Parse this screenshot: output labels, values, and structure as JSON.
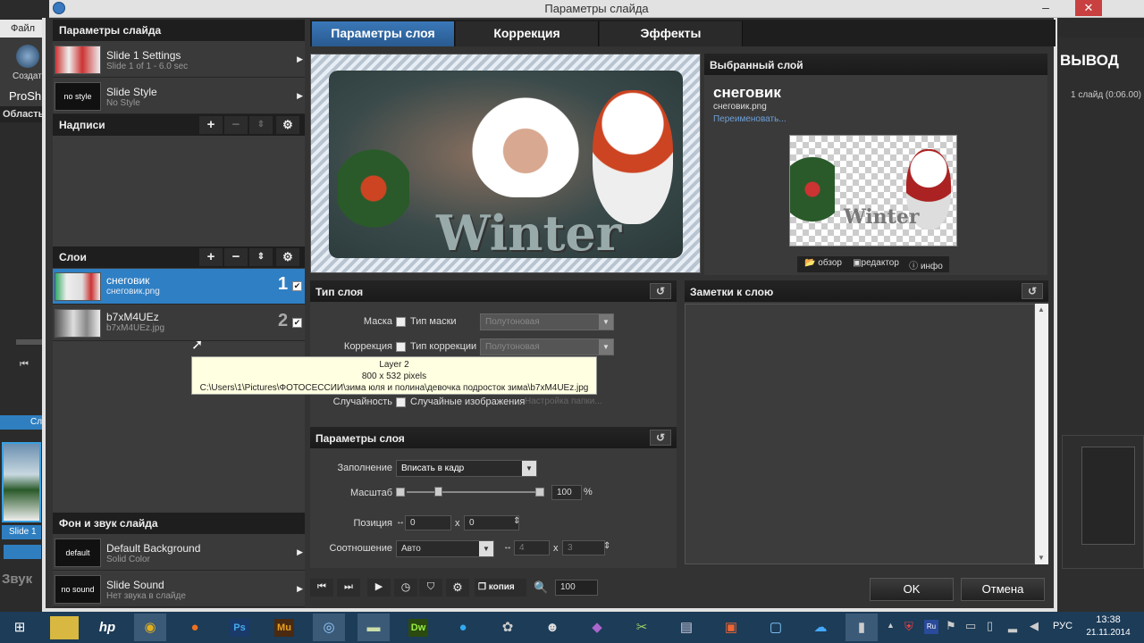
{
  "background_app": {
    "menu_file": "Файл",
    "create_label": "Создат",
    "proshow_label": "ProSh",
    "area_label": "Область",
    "output_label": "ВЫВОД",
    "slide_count": "1 слайд (0:06.00)",
    "slide1_label": "Slide 1",
    "sound_label": "Звук",
    "tab_label": "Сл"
  },
  "window": {
    "title": "Параметры слайда"
  },
  "left": {
    "slide_params_header": "Параметры слайда",
    "slide_settings": {
      "title": "Slide 1 Settings",
      "subtitle": "Slide 1 of 1 - 6.0 sec"
    },
    "slide_style": {
      "thumb": "no style",
      "title": "Slide Style",
      "subtitle": "No Style"
    },
    "captions_header": "Надписи",
    "layers_header": "Слои",
    "layers": [
      {
        "name": "снеговик",
        "file": "снеговик.png",
        "number": "1"
      },
      {
        "name": "b7xM4UEz",
        "file": "b7xM4UEz.jpg",
        "number": "2"
      }
    ],
    "bg_sound_header": "Фон и звук слайда",
    "background": {
      "thumb": "default",
      "title": "Default Background",
      "subtitle": "Solid Color"
    },
    "sound": {
      "thumb": "no sound",
      "title": "Slide Sound",
      "subtitle": "Нет звука в слайде"
    }
  },
  "tabs": [
    "Параметры слоя",
    "Коррекция",
    "Эффекты"
  ],
  "preview": {
    "caption": "Winter"
  },
  "selected_layer": {
    "header": "Выбранный слой",
    "name": "снеговик",
    "file": "снеговик.png",
    "rename": "Переименовать...",
    "thumb_caption": "Winter",
    "buttons": [
      "обзор",
      "редактор",
      "инфо"
    ]
  },
  "layer_type": {
    "header": "Тип слоя",
    "mask_label": "Маска",
    "mask_check": "Тип маски",
    "mask_select": "Полутоновая",
    "correction_label": "Коррекция",
    "correction_check": "Тип коррекции",
    "correction_select": "Полутоновая",
    "random_label": "Случайность",
    "random_check": "Случайные изображения",
    "random_button": "Настройка папки..."
  },
  "tooltip": {
    "line1": "Layer 2",
    "line2": "800 x 532 pixels",
    "line3": "C:\\Users\\1\\Pictures\\ФОТОСЕССИИ\\зима юля и полина\\девочка подросток зима\\b7xM4UEz.jpg"
  },
  "layer_params": {
    "header": "Параметры слоя",
    "fill_label": "Заполнение",
    "fill_value": "Вписать в кадр",
    "scale_label": "Масштаб",
    "scale_value": "100",
    "scale_unit": "%",
    "scale_level": 0.22,
    "position_label": "Позиция",
    "pos_x": "0",
    "pos_y": "0",
    "ratio_label": "Соотношение",
    "ratio_value": "Авто",
    "ratio_w": "4",
    "ratio_h": "3",
    "x_sep": "x"
  },
  "notes": {
    "header": "Заметки к слою"
  },
  "bottom": {
    "copy": "копия",
    "zoom": "100",
    "ok": "OK",
    "cancel": "Отмена"
  },
  "taskbar": {
    "lang": "РУС",
    "time": "13:38",
    "date": "21.11.2014",
    "hp": "hp"
  }
}
